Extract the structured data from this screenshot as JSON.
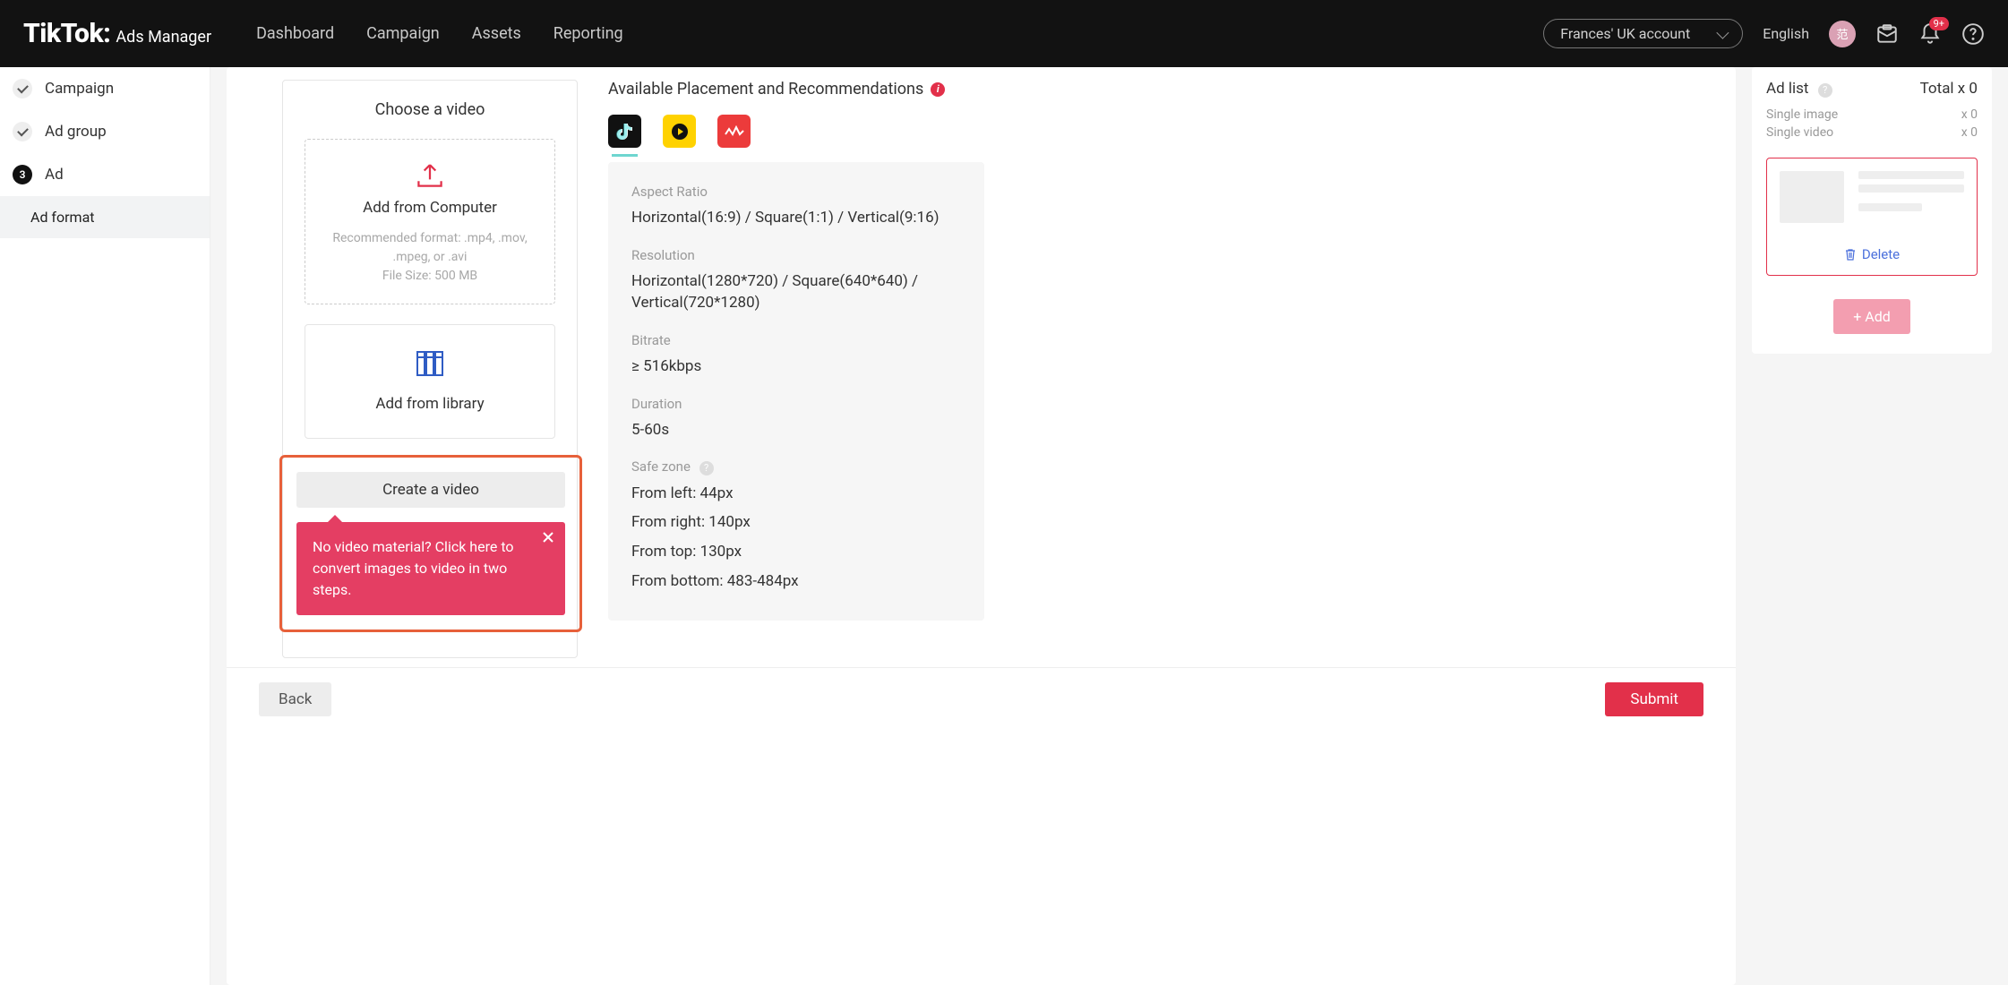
{
  "brand": {
    "logo_main": "TikTok:",
    "logo_sub": "Ads Manager"
  },
  "top_nav": {
    "dashboard": "Dashboard",
    "campaign": "Campaign",
    "assets": "Assets",
    "reporting": "Reporting"
  },
  "header": {
    "account": "Frances' UK account",
    "language": "English",
    "avatar_char": "范",
    "notif_count": "9+"
  },
  "steps": {
    "campaign": "Campaign",
    "adgroup": "Ad group",
    "ad_num": "3",
    "ad": "Ad",
    "ad_format": "Ad format"
  },
  "choose": {
    "title": "Choose a video",
    "upload_title": "Add from Computer",
    "upload_hint_line1": "Recommended format: .mp4, .mov, .mpeg, or .avi",
    "upload_hint_line2": "File Size: 500 MB",
    "library_title": "Add from library",
    "create_btn": "Create a video",
    "tooltip": "No video material? Click here to convert images to video in two steps."
  },
  "placement": {
    "title": "Available Placement and Recommendations",
    "specs": {
      "aspect_label": "Aspect Ratio",
      "aspect_value": "Horizontal(16:9) / Square(1:1) / Vertical(9:16)",
      "res_label": "Resolution",
      "res_value": "Horizontal(1280*720) / Square(640*640) / Vertical(720*1280)",
      "bitrate_label": "Bitrate",
      "bitrate_value": "≥ 516kbps",
      "duration_label": "Duration",
      "duration_value": "5-60s",
      "safezone_label": "Safe zone",
      "sz_left": "From left: 44px",
      "sz_right": "From right: 140px",
      "sz_top": "From top: 130px",
      "sz_bottom": "From bottom: 483-484px"
    }
  },
  "adlist": {
    "title": "Ad list",
    "total": "Total x 0",
    "single_image": "Single image",
    "single_video": "Single video",
    "count_i": "x 0",
    "count_v": "x 0",
    "delete": "Delete",
    "add": "+ Add"
  },
  "footer": {
    "back": "Back",
    "submit": "Submit"
  }
}
